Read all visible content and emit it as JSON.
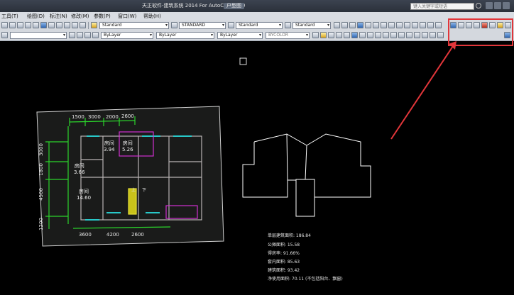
{
  "titlebar": {
    "title": "天正软件-建筑系统 2014  For AutoCAD 2010",
    "document": "户型图",
    "search_placeholder": "键入关键字或短语"
  },
  "menu": [
    "工具(T)",
    "绘图(D)",
    "标注(N)",
    "修改(M)",
    "参数(P)",
    "窗口(W)",
    "帮助(H)"
  ],
  "toolbar1": {
    "text_style": "Standard",
    "dim_style": "STANDARD",
    "table_style": "Standard",
    "multileader_style": "Standard"
  },
  "toolbar2": {
    "layer": "ByLayer",
    "linetype": "ByLayer",
    "lineweight": "ByLayer",
    "plotstyle": "BYCOLOR"
  },
  "plan": {
    "dims_top": [
      "1500",
      "3000",
      "2000",
      "2600"
    ],
    "dims_bottom": [
      "3600",
      "4200",
      "2600"
    ],
    "dims_left": [
      "3000",
      "1800",
      "4500",
      "1200"
    ],
    "rooms": [
      {
        "name": "房间",
        "area": "3.94"
      },
      {
        "name": "房间",
        "area": "5.26"
      },
      {
        "name": "房间",
        "area": "3.66"
      },
      {
        "name": "房间",
        "area": "14.60"
      }
    ],
    "stair_up": "上",
    "stair_down": "下"
  },
  "stats": [
    "单层建筑面积: 186.84",
    "公摊面积: 15.58",
    "得房率: 91.66%",
    "套内面积: 85.63",
    "建筑面积: 93.42",
    "净使用面积: 70.11 (不包括阳台、飘窗)"
  ],
  "colors": {
    "highlight": "#e2363a",
    "wire": "#ffffff",
    "dim": "#2bd42b",
    "wall": "#c8c8c8",
    "window": "#28c8c8",
    "door": "#d030d0"
  }
}
